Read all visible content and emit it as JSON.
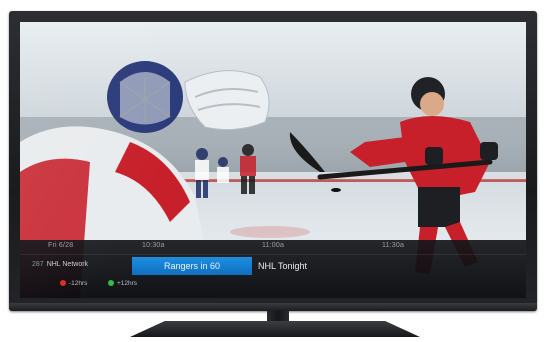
{
  "guide": {
    "date": "Fri 6/28",
    "times": [
      "10:30a",
      "11:00a",
      "11:30a"
    ],
    "channel_number": "287",
    "channel_name": "NHL Network",
    "current_program": "Rangers in 60",
    "next_program": "NHL Tonight",
    "keys": [
      {
        "color": "#e02a2a",
        "label": "-12hrs"
      },
      {
        "color": "#2fbf4a",
        "label": "+12hrs"
      }
    ]
  },
  "colors": {
    "selected_program": "#1583d4",
    "bezel": "#1f2022"
  }
}
